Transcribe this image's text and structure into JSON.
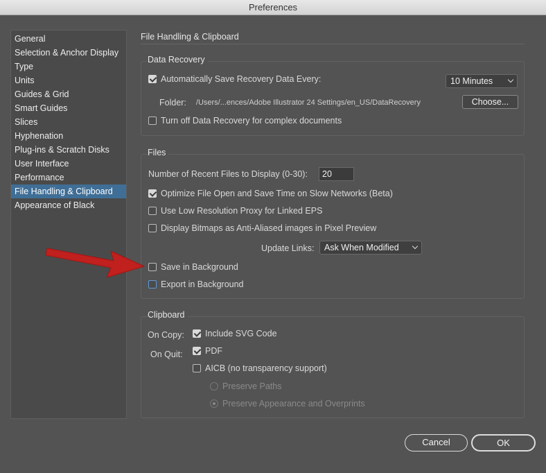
{
  "window": {
    "title": "Preferences"
  },
  "sidebar": {
    "items": [
      {
        "label": "General"
      },
      {
        "label": "Selection & Anchor Display"
      },
      {
        "label": "Type"
      },
      {
        "label": "Units"
      },
      {
        "label": "Guides & Grid"
      },
      {
        "label": "Smart Guides"
      },
      {
        "label": "Slices"
      },
      {
        "label": "Hyphenation"
      },
      {
        "label": "Plug-ins & Scratch Disks"
      },
      {
        "label": "User Interface"
      },
      {
        "label": "Performance"
      },
      {
        "label": "File Handling & Clipboard",
        "selected": true
      },
      {
        "label": "Appearance of Black"
      }
    ]
  },
  "pane": {
    "title": "File Handling & Clipboard"
  },
  "data_recovery": {
    "title": "Data Recovery",
    "auto_save_label": "Automatically Save Recovery Data Every:",
    "auto_save_checked": true,
    "interval": "10 Minutes",
    "folder_label": "Folder:",
    "folder_path": "/Users/...ences/Adobe Illustrator 24 Settings/en_US/DataRecovery",
    "choose_label": "Choose...",
    "turn_off_label": "Turn off Data Recovery for complex documents",
    "turn_off_checked": false
  },
  "files": {
    "title": "Files",
    "recent_label": "Number of Recent Files to Display (0-30):",
    "recent_value": "20",
    "optimize_label": "Optimize File Open and Save Time on Slow Networks (Beta)",
    "optimize_checked": true,
    "low_res_label": "Use Low Resolution Proxy for Linked EPS",
    "low_res_checked": false,
    "bitmaps_label": "Display Bitmaps as Anti-Aliased images in Pixel Preview",
    "bitmaps_checked": false,
    "update_links_label": "Update Links:",
    "update_links_value": "Ask When Modified",
    "save_bg_label": "Save in Background",
    "save_bg_checked": false,
    "export_bg_label": "Export in Background",
    "export_bg_checked": false
  },
  "clipboard": {
    "title": "Clipboard",
    "on_copy_label": "On Copy:",
    "include_svg_label": "Include SVG Code",
    "include_svg_checked": true,
    "on_quit_label": "On Quit:",
    "pdf_label": "PDF",
    "pdf_checked": true,
    "aicb_label": "AICB (no transparency support)",
    "aicb_checked": false,
    "preserve_paths_label": "Preserve Paths",
    "preserve_appearance_label": "Preserve Appearance and Overprints"
  },
  "footer": {
    "cancel_label": "Cancel",
    "ok_label": "OK"
  },
  "colors": {
    "background": "#535353",
    "selection": "#3f6e96",
    "annotation_arrow": "#c0201e"
  },
  "icons": [
    "checkbox-icon",
    "chevron-down-icon",
    "radio-icon",
    "red-arrow-annotation-icon"
  ]
}
